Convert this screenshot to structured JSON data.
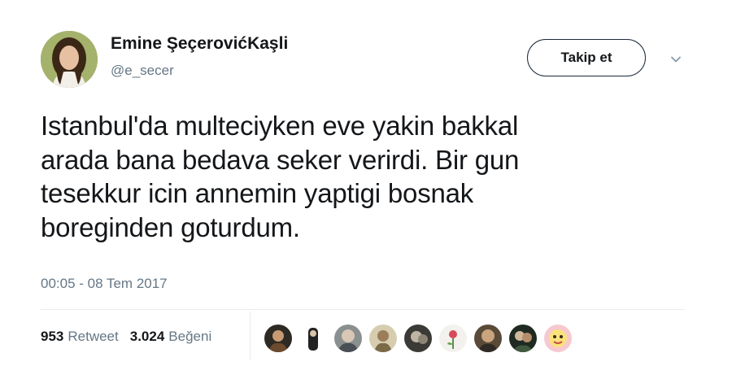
{
  "author": {
    "display_name": "Emine ŞeçerovićKaşli",
    "handle": "@e_secer"
  },
  "follow_button": {
    "label": "Takip et"
  },
  "tweet": {
    "lines": [
      "Istanbul'da multeciyken eve yakin bakkal",
      "arada bana bedava seker verirdi. Bir gun",
      "tesekkur icin annemin yaptigi bosnak",
      "boreginden goturdum."
    ],
    "timestamp": "00:05 - 08 Tem 2017"
  },
  "stats": {
    "retweets": {
      "count": "953",
      "label": "Retweet"
    },
    "likes": {
      "count": "3.024",
      "label": "Beğeni"
    }
  },
  "colors": {
    "text_primary": "#14171a",
    "text_secondary": "#657786",
    "divider": "#e6ecf0"
  },
  "icons": {
    "menu_caret": "chevron-down-icon"
  }
}
